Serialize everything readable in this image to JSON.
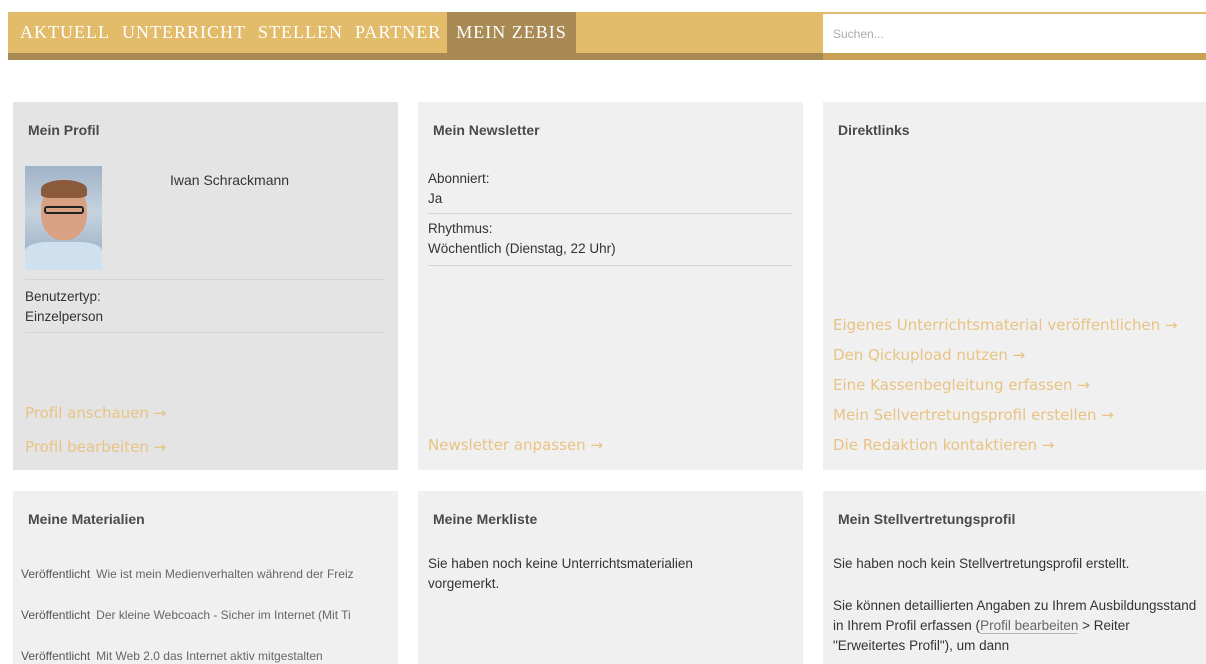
{
  "nav": {
    "items": [
      "AKTUELL",
      "UNTERRICHT",
      "STELLEN",
      "PARTNER",
      "MEIN ZEBIS"
    ],
    "active": "MEIN ZEBIS"
  },
  "search": {
    "placeholder": "Suchen..."
  },
  "profile": {
    "title": "Mein Profil",
    "name": "Iwan Schrackmann",
    "usertype_label": "Benutzertyp:",
    "usertype_value": "Einzelperson",
    "link_view": "Profil anschauen →",
    "link_edit": "Profil bearbeiten →"
  },
  "newsletter": {
    "title": "Mein Newsletter",
    "subscribed_label": "Abonniert:",
    "subscribed_value": "Ja",
    "rhythm_label": "Rhythmus:",
    "rhythm_value": "Wöchentlich (Dienstag, 22 Uhr)",
    "link_adjust": "Newsletter anpassen →"
  },
  "direct": {
    "title": "Direktlinks",
    "links": [
      "Eigenes Unterrichtsmaterial veröffentlichen →",
      "Den Qickupload nutzen →",
      "Eine Kassenbegleitung erfassen →",
      "Mein Sellvertretungsprofil erstellen →",
      "Die Redaktion kontaktieren →"
    ]
  },
  "materials": {
    "title": "Meine Materialien",
    "rows": [
      {
        "status": "Veröffentlicht",
        "title": "Wie ist mein Medienverhalten während der Freiz"
      },
      {
        "status": "Veröffentlicht",
        "title": "Der kleine Webcoach - Sicher im Internet (Mit Ti"
      },
      {
        "status": "Veröffentlicht",
        "title": "Mit Web 2.0 das Internet aktiv mitgestalten"
      }
    ]
  },
  "watchlist": {
    "title": "Meine Merkliste",
    "text": "Sie haben noch keine Unterrichtsmaterialien vorgemerkt."
  },
  "substitute": {
    "title": "Mein Stellvertretungsprofil",
    "text1": "Sie haben noch kein Stellvertretungsprofil erstellt.",
    "text2_a": "Sie können detaillierten Angaben zu Ihrem Ausbildungsstand in Ihrem Profil erfassen (",
    "text2_link": "Profil bearbeiten",
    "text2_b": " > Reiter \"Erweitertes Profil\"), um dann"
  },
  "colors": {
    "gold": "#e2bb6b",
    "gold_dark": "#a98a55",
    "link": "#e8c384",
    "card_bg": "#f0f0f0"
  }
}
